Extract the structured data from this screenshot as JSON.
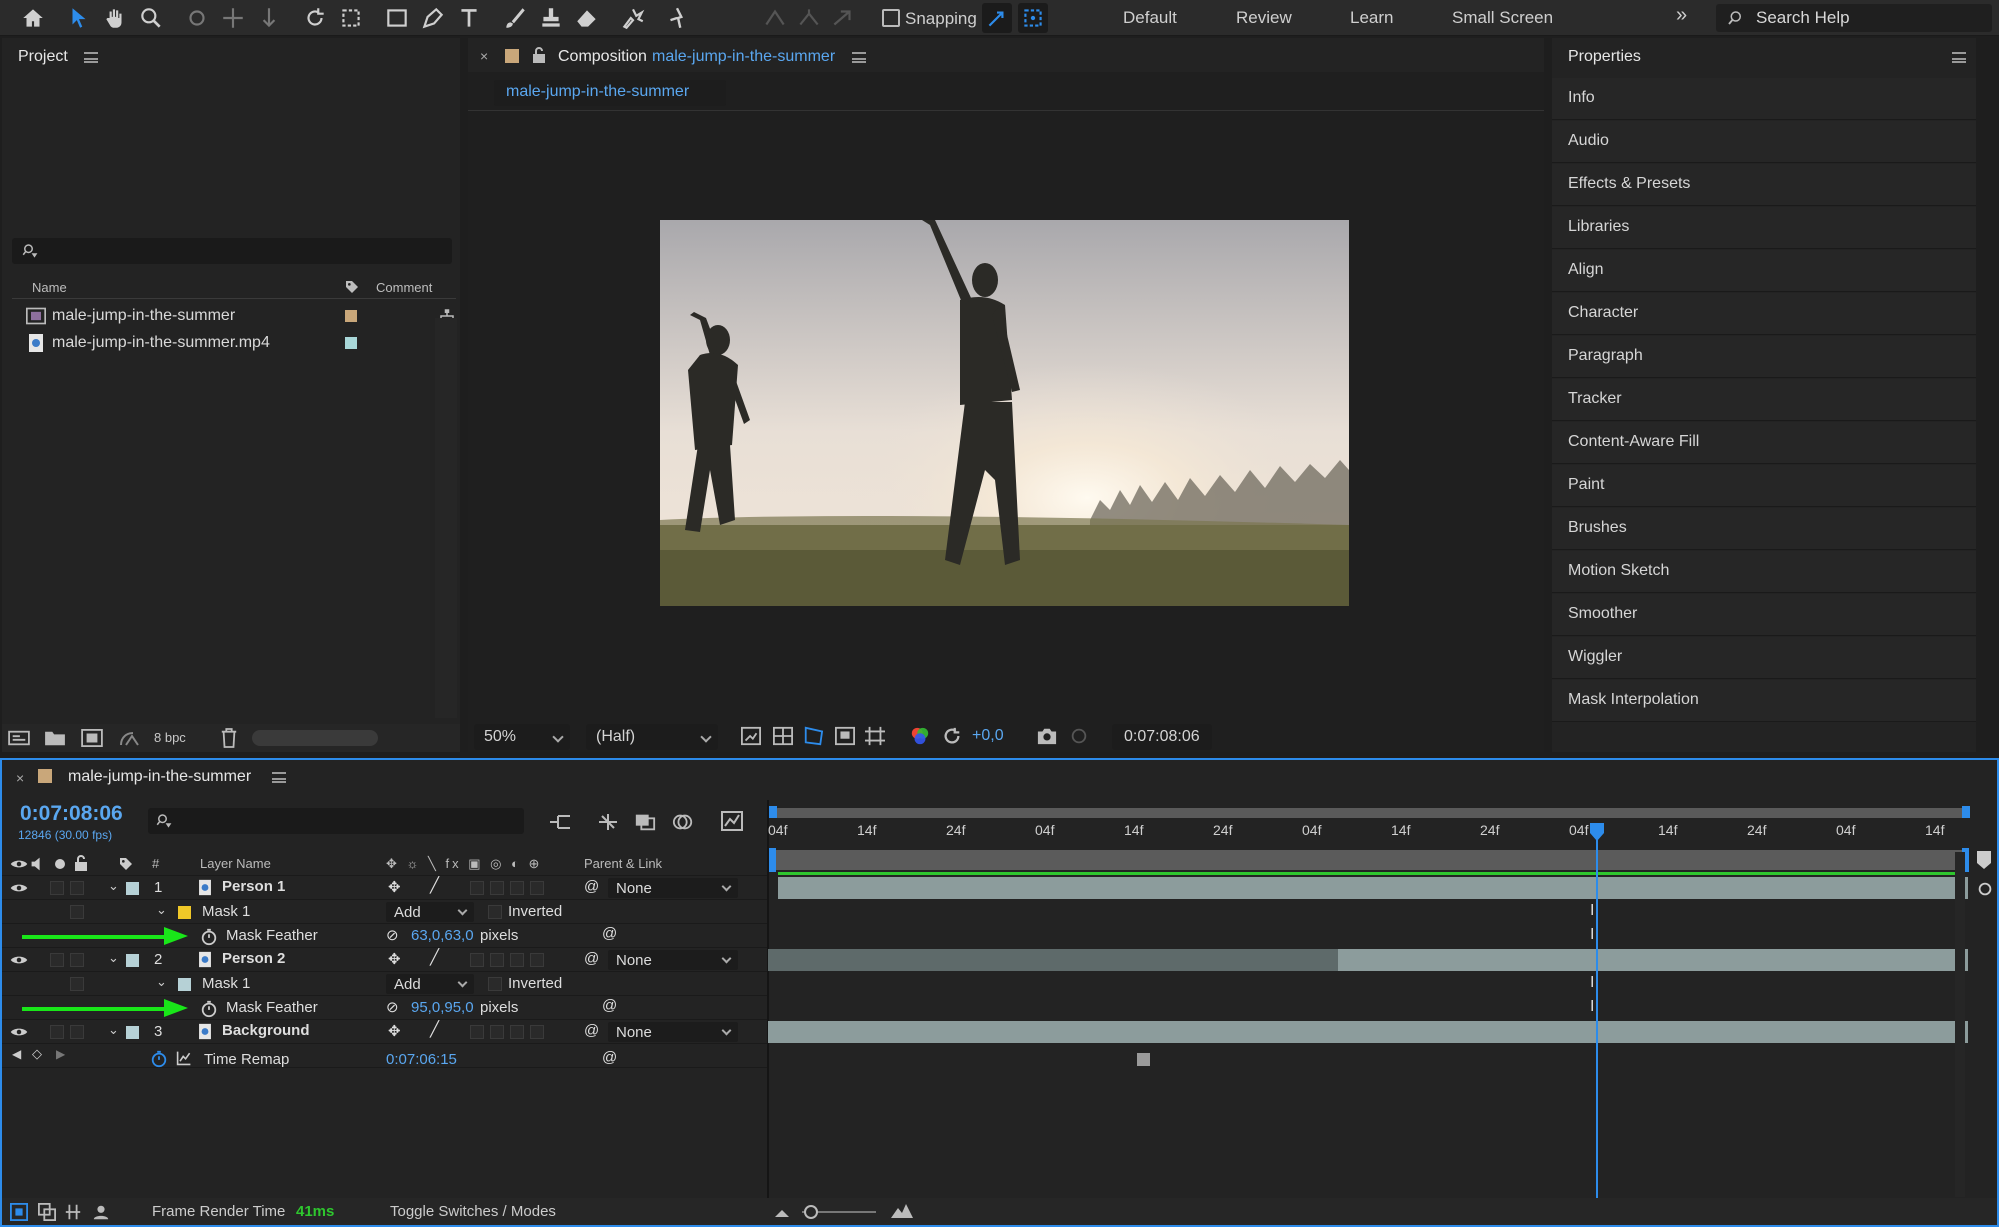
{
  "toolbar": {
    "snapping": "Snapping",
    "workspaces": [
      "Default",
      "Review",
      "Learn",
      "Small Screen"
    ],
    "search_placeholder": "Search Help"
  },
  "project": {
    "title": "Project",
    "col_name": "Name",
    "col_comment": "Comment",
    "items": [
      {
        "name": "male-jump-in-the-summer",
        "swatch": "#c9a77a"
      },
      {
        "name": "male-jump-in-the-summer.mp4",
        "swatch": "#a8d7d8"
      }
    ],
    "bpc": "8 bpc"
  },
  "composition": {
    "title_prefix": "Composition",
    "title_name": "male-jump-in-the-summer",
    "tab": "male-jump-in-the-summer",
    "zoom": "50%",
    "resolution": "(Half)",
    "exposure": "+0,0",
    "timecode": "0:07:08:06"
  },
  "properties": {
    "title": "Properties",
    "items": [
      "Info",
      "Audio",
      "Effects & Presets",
      "Libraries",
      "Align",
      "Character",
      "Paragraph",
      "Tracker",
      "Content-Aware Fill",
      "Paint",
      "Brushes",
      "Motion Sketch",
      "Smoother",
      "Wiggler",
      "Mask Interpolation"
    ]
  },
  "timeline": {
    "comp_name": "male-jump-in-the-summer",
    "current_time": "0:07:08:06",
    "frame_info": "12846 (30.00 fps)",
    "col_layer_name": "Layer Name",
    "col_parent": "Parent & Link",
    "col_hash": "#",
    "layers": [
      {
        "num": "1",
        "name": "Person 1",
        "parent": "None",
        "mask": "Mask 1",
        "mode": "Add",
        "inverted": "Inverted",
        "prop": "Mask Feather",
        "value": "63,0,63,0",
        "unit": "pixels"
      },
      {
        "num": "2",
        "name": "Person 2",
        "parent": "None",
        "mask": "Mask 1",
        "mode": "Add",
        "inverted": "Inverted",
        "prop": "Mask Feather",
        "value": "95,0,95,0",
        "unit": "pixels"
      },
      {
        "num": "3",
        "name": "Background",
        "parent": "None",
        "prop": "Time Remap",
        "value": "0:07:06:15"
      }
    ],
    "ruler": [
      "04f",
      "14f",
      "24f",
      "04f",
      "14f",
      "24f",
      "04f",
      "14f",
      "24f",
      "04f",
      "14f",
      "24f",
      "04f",
      "14f"
    ],
    "footer": {
      "render_label": "Frame Render Time",
      "render_value": "41ms",
      "toggle": "Toggle Switches / Modes"
    }
  }
}
